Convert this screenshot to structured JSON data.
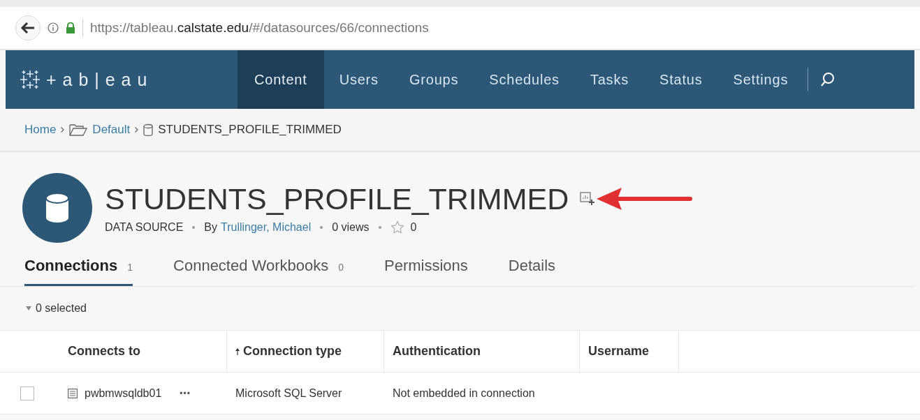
{
  "browser": {
    "url": {
      "scheme_part": "https://tableau.",
      "domain": "calstate.edu",
      "path": "/#/datasources/66/connections"
    }
  },
  "nav": {
    "logo": "+ a b | e a u",
    "items": [
      {
        "label": "Content",
        "selected": true
      },
      {
        "label": "Users",
        "selected": false
      },
      {
        "label": "Groups",
        "selected": false
      },
      {
        "label": "Schedules",
        "selected": false
      },
      {
        "label": "Tasks",
        "selected": false
      },
      {
        "label": "Status",
        "selected": false
      },
      {
        "label": "Settings",
        "selected": false
      }
    ]
  },
  "breadcrumb": [
    {
      "label": "Home",
      "kind": "link"
    },
    {
      "label": "Default",
      "kind": "folder"
    },
    {
      "label": "STUDENTS_PROFILE_TRIMMED",
      "kind": "datasource"
    }
  ],
  "header": {
    "title": "STUDENTS_PROFILE_TRIMMED",
    "type": "DATA SOURCE",
    "by": "By",
    "owner": "Trullinger, Michael",
    "views": "0 views",
    "favorites": "0"
  },
  "tabs": [
    {
      "label": "Connections",
      "count": "1",
      "selected": true
    },
    {
      "label": "Connected Workbooks",
      "count": "0",
      "selected": false
    },
    {
      "label": "Permissions",
      "selected": false
    },
    {
      "label": "Details",
      "selected": false
    }
  ],
  "selection": "0 selected",
  "table": {
    "columns": [
      {
        "label": "Connects to",
        "sorted": false
      },
      {
        "label": "Connection type",
        "sorted": true
      },
      {
        "label": "Authentication",
        "sorted": false
      },
      {
        "label": "Username",
        "sorted": false
      }
    ],
    "rows": [
      {
        "checked": false,
        "name": "pwbmwsqldb01",
        "more": "•••",
        "type": "Microsoft SQL Server",
        "authentication": "Not embedded in connection"
      }
    ]
  }
}
